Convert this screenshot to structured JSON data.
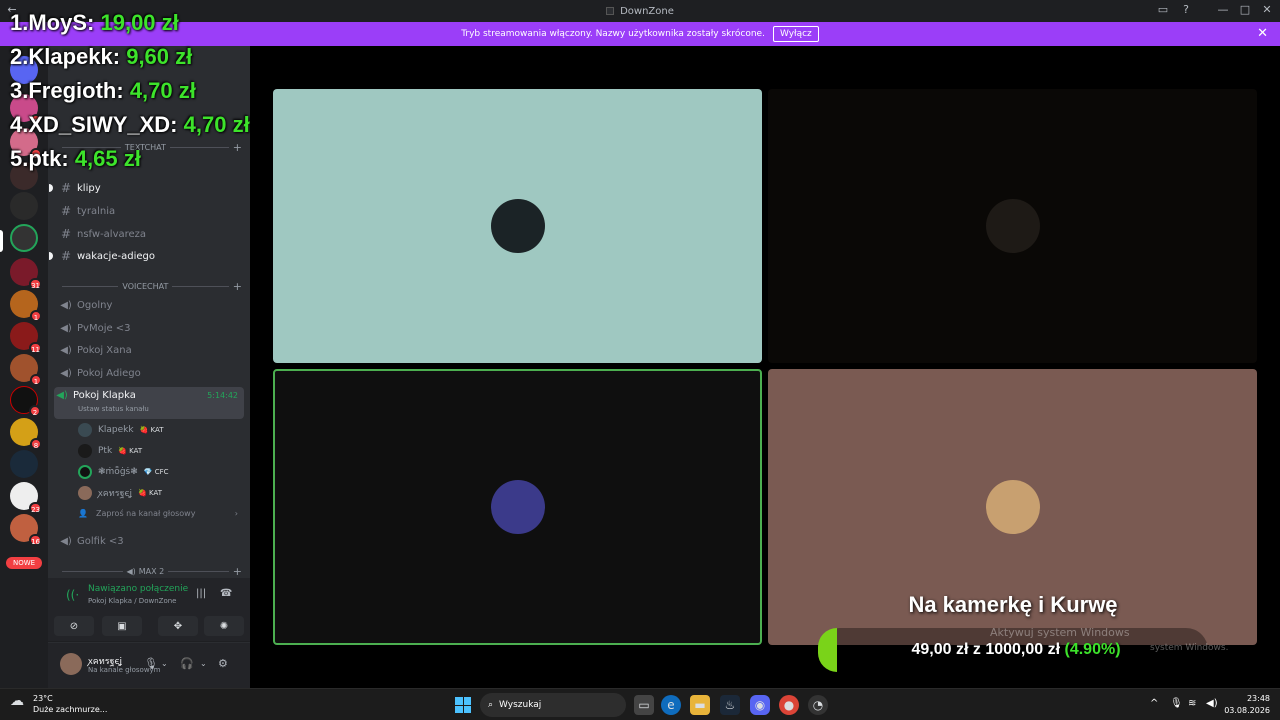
{
  "window": {
    "title": "DownZone",
    "controls": [
      "—",
      "□",
      "✕"
    ]
  },
  "banner": {
    "text": "Tryb streamowania włączony. Nazwy użytkownika zostały skrócone.",
    "button": "Wyłącz"
  },
  "donors": [
    {
      "rank": "1.",
      "name": "MoyS:",
      "amount": "19,00 zł"
    },
    {
      "rank": "2.",
      "name": "Klapekk:",
      "amount": "9,60 zł"
    },
    {
      "rank": "3.",
      "name": "Fregioth:",
      "amount": "4,70 zł"
    },
    {
      "rank": "4.",
      "name": "XD_SIWY_XD:",
      "amount": "4,70 zł"
    },
    {
      "rank": "5.",
      "name": "ptk:",
      "amount": "4,65 zł"
    }
  ],
  "rail": {
    "badges": [
      "1",
      "3",
      "1",
      "31",
      "1",
      "11",
      "1",
      "2",
      "8",
      "23",
      "16"
    ],
    "new_label": "NOWE"
  },
  "sidebar": {
    "textchat_header": "TEXTCHAT",
    "text_channels": [
      {
        "name": "klipy",
        "bold": true
      },
      {
        "name": "tyralnia",
        "bold": false
      },
      {
        "name": "nsfw-alvareza",
        "bold": false
      },
      {
        "name": "wakacje-adiego",
        "bold": true
      }
    ],
    "voicechat_header": "VOICECHAT",
    "voice_channels": [
      {
        "name": "Ogolny"
      },
      {
        "name": "PvMoje <3"
      },
      {
        "name": "Pokoj Xana"
      },
      {
        "name": "Pokoj Adiego"
      }
    ],
    "active_channel": {
      "name": "Pokoj Klapka",
      "timer": "5:14:42",
      "status": "Ustaw status kanału"
    },
    "members": [
      {
        "name": "Klapekk",
        "tag": "KAT",
        "color": "#3a4a52"
      },
      {
        "name": "Ptk",
        "tag": "KAT",
        "color": "#1a1a1a"
      },
      {
        "name": "❃ṁȫġṡ❃",
        "tag": "CFC",
        "color": "#23a55a"
      },
      {
        "name": "ꭗคทรฐєʝ",
        "tag": "KAT",
        "color": "#8a6a5a"
      }
    ],
    "invite": "Zaproś na kanał głosowy",
    "after_channel": "Golfik <3",
    "max_header": "MAX 2"
  },
  "voice": {
    "status": "Nawiązano połączenie",
    "location": "Pokoj Klapka / DownZone"
  },
  "user": {
    "name": "ꭗคทรฐєʝ",
    "status": "Na kanale głosowym"
  },
  "tiles": [
    {
      "bg": "#9fc8c1",
      "avatar": "#1b2326",
      "border": "none"
    },
    {
      "bg": "#0a0806",
      "avatar": "#1e1a16",
      "border": "none"
    },
    {
      "bg": "#0f0f0f",
      "avatar": "#3b3a8a",
      "border": "#4caf50"
    },
    {
      "bg": "#7a5a52",
      "avatar": "#c8a070",
      "border": "none"
    }
  ],
  "goal": {
    "title": "Na kamerkę i Kurwę",
    "current": "49,00 zł",
    "joiner": "z",
    "target": "1000,00 zł",
    "percent": "(4.90%)",
    "fraction": 0.049
  },
  "watermark": {
    "line1": "Aktywuj system Windows",
    "line2": "system Windows."
  },
  "taskbar": {
    "temp": "23°C",
    "condition": "Duże zachmurze...",
    "search": "Wyszukaj",
    "time": "23:48",
    "date": "03.08.2026"
  }
}
